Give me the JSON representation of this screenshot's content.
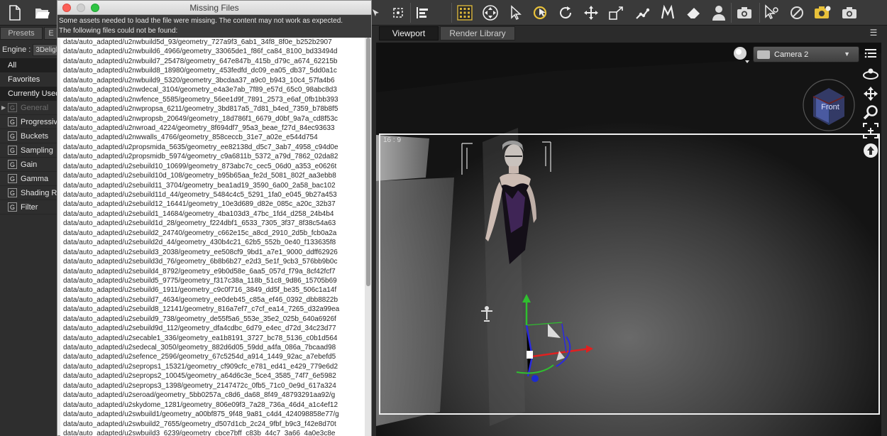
{
  "toolbar": {
    "icons": [
      "new-file-icon",
      "open-folder-icon",
      "node-select-icon",
      "universal-select-icon",
      "align-icon",
      "grid-icon",
      "universal-tool-icon",
      "pointer-icon",
      "active-pose-icon",
      "rotate-icon",
      "translate-icon",
      "scale-icon",
      "joint-editor-icon",
      "morph-icon",
      "eraser-icon",
      "figure-icon",
      "camera-icon",
      "surface-icon",
      "geometry-icon",
      "render-settings-icon",
      "render-icon"
    ]
  },
  "left_panel": {
    "tabs": [
      "Presets",
      "E"
    ],
    "engine_label": "Engine :",
    "engine_value": "3Deligh",
    "filters": [
      "All",
      "Favorites",
      "Currently Used"
    ],
    "items": [
      "General",
      "Progressive",
      "Buckets",
      "Sampling",
      "Gain",
      "Gamma",
      "Shading R",
      "Filter"
    ],
    "item_badge": "G"
  },
  "dialog": {
    "title": "Missing Files",
    "message_line1": "Some assets needed to load the file were missing. The content may not work as expected.",
    "message_line2": "The following files could not be found:",
    "files": [
      "data/auto_adapted/u2nwbuild5d_93/geometry_727a9f3_6ab1_34f8_8f0e_b252b2907",
      "data/auto_adapted/u2nwbuild6_4966/geometry_33065de1_f86f_ca84_8100_bd33494d",
      "data/auto_adapted/u2nwbuild7_25478/geometry_647e847b_415b_d79c_a674_62215b",
      "data/auto_adapted/u2nwbuild8_18980/geometry_453fedfd_dc09_ea05_db37_5dd0a1c",
      "data/auto_adapted/u2nwbuild9_5320/geometry_3bcdaa37_a9c0_b943_10c4_57fa4b6",
      "data/auto_adapted/u2nwdecal_3104/geometry_e4a3e7ab_7f89_e57d_65c0_98abc8d3",
      "data/auto_adapted/u2nwfence_5585/geometry_56ee1d9f_7891_2573_e6af_0fb1bb393",
      "data/auto_adapted/u2nwpropsa_6211/geometry_3bd817a5_7d81_b4ed_7359_b78b8f5",
      "data/auto_adapted/u2nwpropsb_20649/geometry_18d786f1_6679_d0bf_9a7a_cd8f53c",
      "data/auto_adapted/u2nwroad_4224/geometry_8f694df7_95a3_beae_f27d_84ec93633",
      "data/auto_adapted/u2nwwalls_4766/geometry_858ceccb_31e7_a02e_e544d754",
      "data/auto_adapted/u2propsmida_5635/geometry_ee82138d_d5c7_3ab7_4958_c94d0e",
      "data/auto_adapted/u2propsmidb_5974/geometry_c9a6811b_5372_a79d_7862_02da82",
      "data/auto_adapted/u2sebuild10_10699/geometry_873abc7c_cec5_06d0_a353_e0626t",
      "data/auto_adapted/u2sebuild10d_108/geometry_b95b65aa_fe2d_5081_802f_aa3ebb8",
      "data/auto_adapted/u2sebuild11_3704/geometry_bea1ad19_3590_6a00_2a58_bac102",
      "data/auto_adapted/u2sebuild11d_44/geometry_5484c4c5_5291_1fa0_e045_9b27a453",
      "data/auto_adapted/u2sebuild12_16441/geometry_10e3d689_d82e_085c_a20c_32b37",
      "data/auto_adapted/u2sebuild1_14684/geometry_4ba103d3_47bc_1fd4_d258_24b4b4",
      "data/auto_adapted/u2sebuild1d_28/geometry_f224dbf1_6533_7305_3f37_8f38c54a63",
      "data/auto_adapted/u2sebuild2_24740/geometry_c662e15c_a8cd_2910_2d5b_fcb0a2a",
      "data/auto_adapted/u2sebuild2d_44/geometry_430b4c21_62b5_552b_0e40_f133635f8",
      "data/auto_adapted/u2sebuild3_2038/geometry_ee508cf9_9bd1_a7e1_9000_ddff62926",
      "data/auto_adapted/u2sebuild3d_76/geometry_6b8b6b27_e2d3_5e1f_9cb3_576bb9b0c",
      "data/auto_adapted/u2sebuild4_8792/geometry_e9b0d58e_6aa5_057d_f79a_8cf42fcf7",
      "data/auto_adapted/u2sebuild5_9775/geometry_f317c38a_118b_51c8_9d86_15705b69",
      "data/auto_adapted/u2sebuild6_1911/geometry_c9c0f716_3849_dd5f_be35_506c1a14f",
      "data/auto_adapted/u2sebuild7_4634/geometry_ee0deb45_c85a_ef46_0392_dbb8822b",
      "data/auto_adapted/u2sebuild8_12141/geometry_816a7ef7_c7cf_ea14_7265_d32a99ea",
      "data/auto_adapted/u2sebuild9_738/geometry_de55f5a6_553e_35e2_025b_640a6926f",
      "data/auto_adapted/u2sebuild9d_112/geometry_dfa4cdbc_6d79_e4ec_d72d_34c23d77",
      "data/auto_adapted/u2secable1_336/geometry_ea1b8191_3727_bc78_5136_c0b1d564",
      "data/auto_adapted/u2sedecal_3050/geometry_882d6d05_59dd_a4fa_086a_7bcaad98",
      "data/auto_adapted/u2sefence_2596/geometry_67c5254d_a914_1449_92ac_a7ebefd5",
      "data/auto_adapted/u2seprops1_15321/geometry_cf909cfc_e781_ed41_e429_779e6d2",
      "data/auto_adapted/u2seprops2_10045/geometry_a64d6c3e_5ce4_3585_74f7_6e5982",
      "data/auto_adapted/u2seprops3_1398/geometry_2147472c_0fb5_71c0_0e9d_617a324",
      "data/auto_adapted/u2seroad/geometry_5bb0257a_c8d6_da68_8f49_48793291aa92/g",
      "data/auto_adapted/u2skydome_1281/geometry_806e09f3_7a28_736a_46d4_a1c4ef12",
      "data/auto_adapted/u2swbuild1/geometry_a00bf875_9f48_9a81_c4d4_424098858e77/g",
      "data/auto_adapted/u2swbuild2_7655/geometry_d507d1cb_2c24_9fbf_b9c3_f42e8d70t",
      "data/auto_adapted/u2swbuild3_6239/geometry_cbce7bff_c83b_44c7_3a66_4a0e3c8e"
    ]
  },
  "viewport": {
    "tabs": [
      "Viewport",
      "Render Library"
    ],
    "camera": "Camera 2",
    "aspect_ratio": "16 : 9",
    "cube_label": "Front",
    "right_icons": [
      "menu-icon",
      "orbit-icon",
      "pan-icon",
      "zoom-icon",
      "frame-icon",
      "reset-icon"
    ]
  }
}
